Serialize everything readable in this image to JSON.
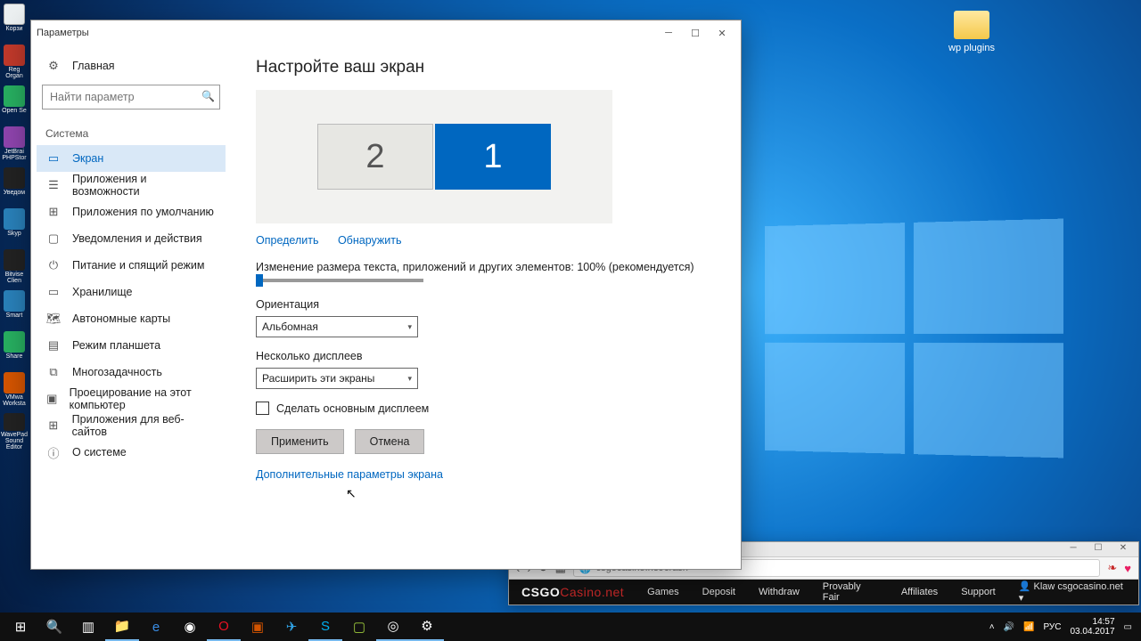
{
  "desktop": {
    "folder_label": "wp plugins",
    "icons": [
      "Корзи",
      "Reg Organ",
      "Open Se",
      "JetBrai PHPStor",
      "Уведом",
      "Skyp",
      "Bitvise Clien",
      "Smart",
      "Share",
      "VMwa Worksta",
      "WavePad Sound Editor"
    ]
  },
  "settings": {
    "title": "Параметры",
    "home": "Главная",
    "search_placeholder": "Найти параметр",
    "category": "Система",
    "items": [
      {
        "icon": "▭",
        "label": "Экран",
        "active": true
      },
      {
        "icon": "☰",
        "label": "Приложения и возможности"
      },
      {
        "icon": "⊞",
        "label": "Приложения по умолчанию"
      },
      {
        "icon": "▢",
        "label": "Уведомления и действия"
      },
      {
        "icon": "⏻",
        "label": "Питание и спящий режим"
      },
      {
        "icon": "▭",
        "label": "Хранилище"
      },
      {
        "icon": "🗺",
        "label": "Автономные карты"
      },
      {
        "icon": "▤",
        "label": "Режим планшета"
      },
      {
        "icon": "⧉",
        "label": "Многозадачность"
      },
      {
        "icon": "▣",
        "label": "Проецирование на этот компьютер"
      },
      {
        "icon": "⊞",
        "label": "Приложения для веб-сайтов"
      },
      {
        "icon": "ⓘ",
        "label": "О системе"
      }
    ],
    "main": {
      "heading": "Настройте ваш экран",
      "monitor2": "2",
      "monitor1": "1",
      "identify": "Определить",
      "detect": "Обнаружить",
      "scale_label": "Изменение размера текста, приложений и других элементов: 100% (рекомендуется)",
      "orientation_label": "Ориентация",
      "orientation_value": "Альбомная",
      "multi_label": "Несколько дисплеев",
      "multi_value": "Расширить эти экраны",
      "make_main": "Сделать основным дисплеем",
      "apply": "Применить",
      "cancel": "Отмена",
      "advanced": "Дополнительные параметры экрана"
    }
  },
  "browser": {
    "url": "csgocasino.net/crash",
    "logo_a": "CSGO",
    "logo_b": "Casino.net",
    "nav": [
      "Games",
      "Deposit",
      "Withdraw",
      "Provably Fair",
      "Affiliates",
      "Support"
    ],
    "user": "Klaw csgocasino.net"
  },
  "tray": {
    "lang": "РУС",
    "time": "14:57",
    "date": "03.04.2017"
  }
}
